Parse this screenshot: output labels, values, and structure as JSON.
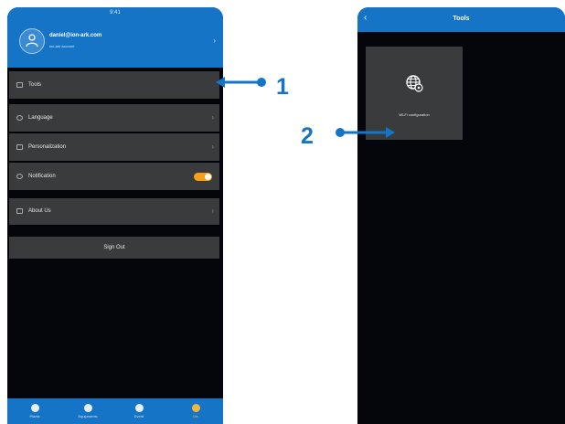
{
  "phone1": {
    "status_bar": "9:41",
    "user": {
      "email": "daniel@ion-ark.com",
      "subtitle": "ion-ark account"
    },
    "menu": [
      {
        "label": "Tools"
      },
      {
        "label": "Language"
      },
      {
        "label": "Personalization"
      },
      {
        "label": "Notification",
        "toggle": true
      },
      {
        "label": "About Us"
      }
    ],
    "sign_out": "Sign Out",
    "tabs": [
      {
        "label": "Plants"
      },
      {
        "label": "Equipments"
      },
      {
        "label": "Event"
      },
      {
        "label": "Me",
        "active": true
      }
    ]
  },
  "phone2": {
    "title": "Tools",
    "tiles": [
      {
        "label": "Wi-Fi configuration"
      }
    ]
  },
  "annotations": [
    {
      "label": "1"
    },
    {
      "label": "2"
    }
  ],
  "colors": {
    "accent": "#1674c6",
    "row_bg": "#3a3b3d",
    "screen_bg": "#04060c",
    "toggle_on": "#f4a019"
  }
}
